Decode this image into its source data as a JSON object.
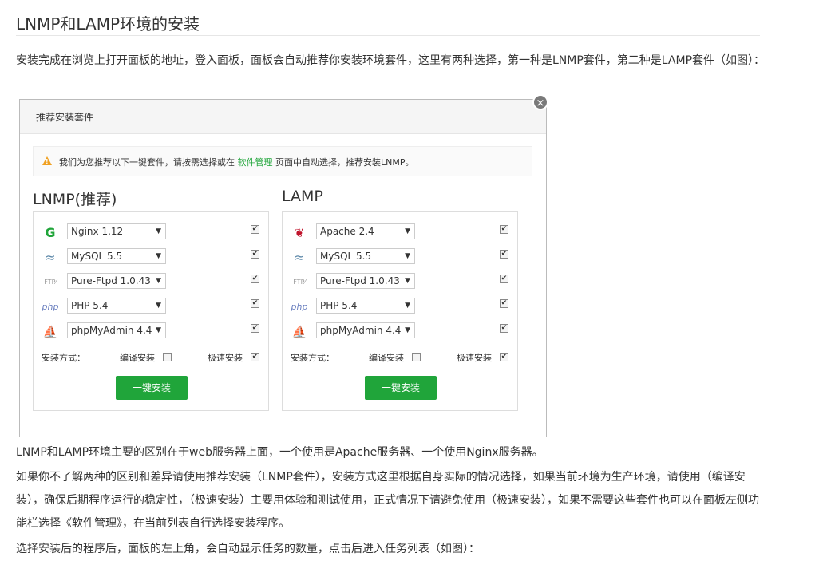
{
  "title": "LNMP和LAMP环境的安装",
  "intro": "安装完成在浏览上打开面板的地址，登入面板，面板会自动推荐你安装环境套件，这里有两种选择，第一种是LNMP套件，第二种是LAMP套件（如图）：",
  "dialog": {
    "title": "推荐安装套件",
    "close": "×",
    "notice_before": "我们为您推荐以下一键套件，请按需选择或在",
    "notice_link": "软件管理",
    "notice_after": "页面中自动选择，推荐安装LNMP。",
    "lnmp": {
      "title": "LNMP(推荐)",
      "rows": [
        {
          "icon": "nginx-icon",
          "value": "Nginx 1.12",
          "checked": true
        },
        {
          "icon": "mysql-icon",
          "value": "MySQL 5.5",
          "checked": true
        },
        {
          "icon": "ftp-icon",
          "value": "Pure-Ftpd 1.0.43",
          "checked": true
        },
        {
          "icon": "php-icon",
          "value": "PHP 5.4",
          "checked": true
        },
        {
          "icon": "phpmyadmin-icon",
          "value": "phpMyAdmin 4.4",
          "checked": true
        }
      ],
      "method_label": "安装方式：",
      "compile_label": "编译安装",
      "fast_label": "极速安装",
      "compile_checked": false,
      "fast_checked": true,
      "install_button": "一键安装"
    },
    "lamp": {
      "title": "LAMP",
      "rows": [
        {
          "icon": "apache-icon",
          "value": "Apache 2.4",
          "checked": true
        },
        {
          "icon": "mysql-icon",
          "value": "MySQL 5.5",
          "checked": true
        },
        {
          "icon": "ftp-icon",
          "value": "Pure-Ftpd 1.0.43",
          "checked": true
        },
        {
          "icon": "php-icon",
          "value": "PHP 5.4",
          "checked": true
        },
        {
          "icon": "phpmyadmin-icon",
          "value": "phpMyAdmin 4.4",
          "checked": true
        }
      ],
      "method_label": "安装方式：",
      "compile_label": "编译安装",
      "fast_label": "极速安装",
      "compile_checked": false,
      "fast_checked": true,
      "install_button": "一键安装"
    }
  },
  "para2": "LNMP和LAMP环境主要的区别在于web服务器上面，一个使用是Apache服务器、一个使用Nginx服务器。",
  "para3": "如果你不了解两种的区别和差异请使用推荐安装（LNMP套件），安装方式这里根据自身实际的情况选择，如果当前环境为生产环境，请使用（编译安装），确保后期程序运行的稳定性，（极速安装）主要用体验和测试使用，正式情况下请避免使用（极速安装），如果不需要这些套件也可以在面板左侧功能栏选择《软件管理》，在当前列表自行选择安装程序。",
  "para4": "选择安装后的程序后，面板的左上角，会自动显示任务的数量，点击后进入任务列表（如图）：",
  "colors": {
    "accent": "#20a53a",
    "warn": "#f0a020"
  }
}
